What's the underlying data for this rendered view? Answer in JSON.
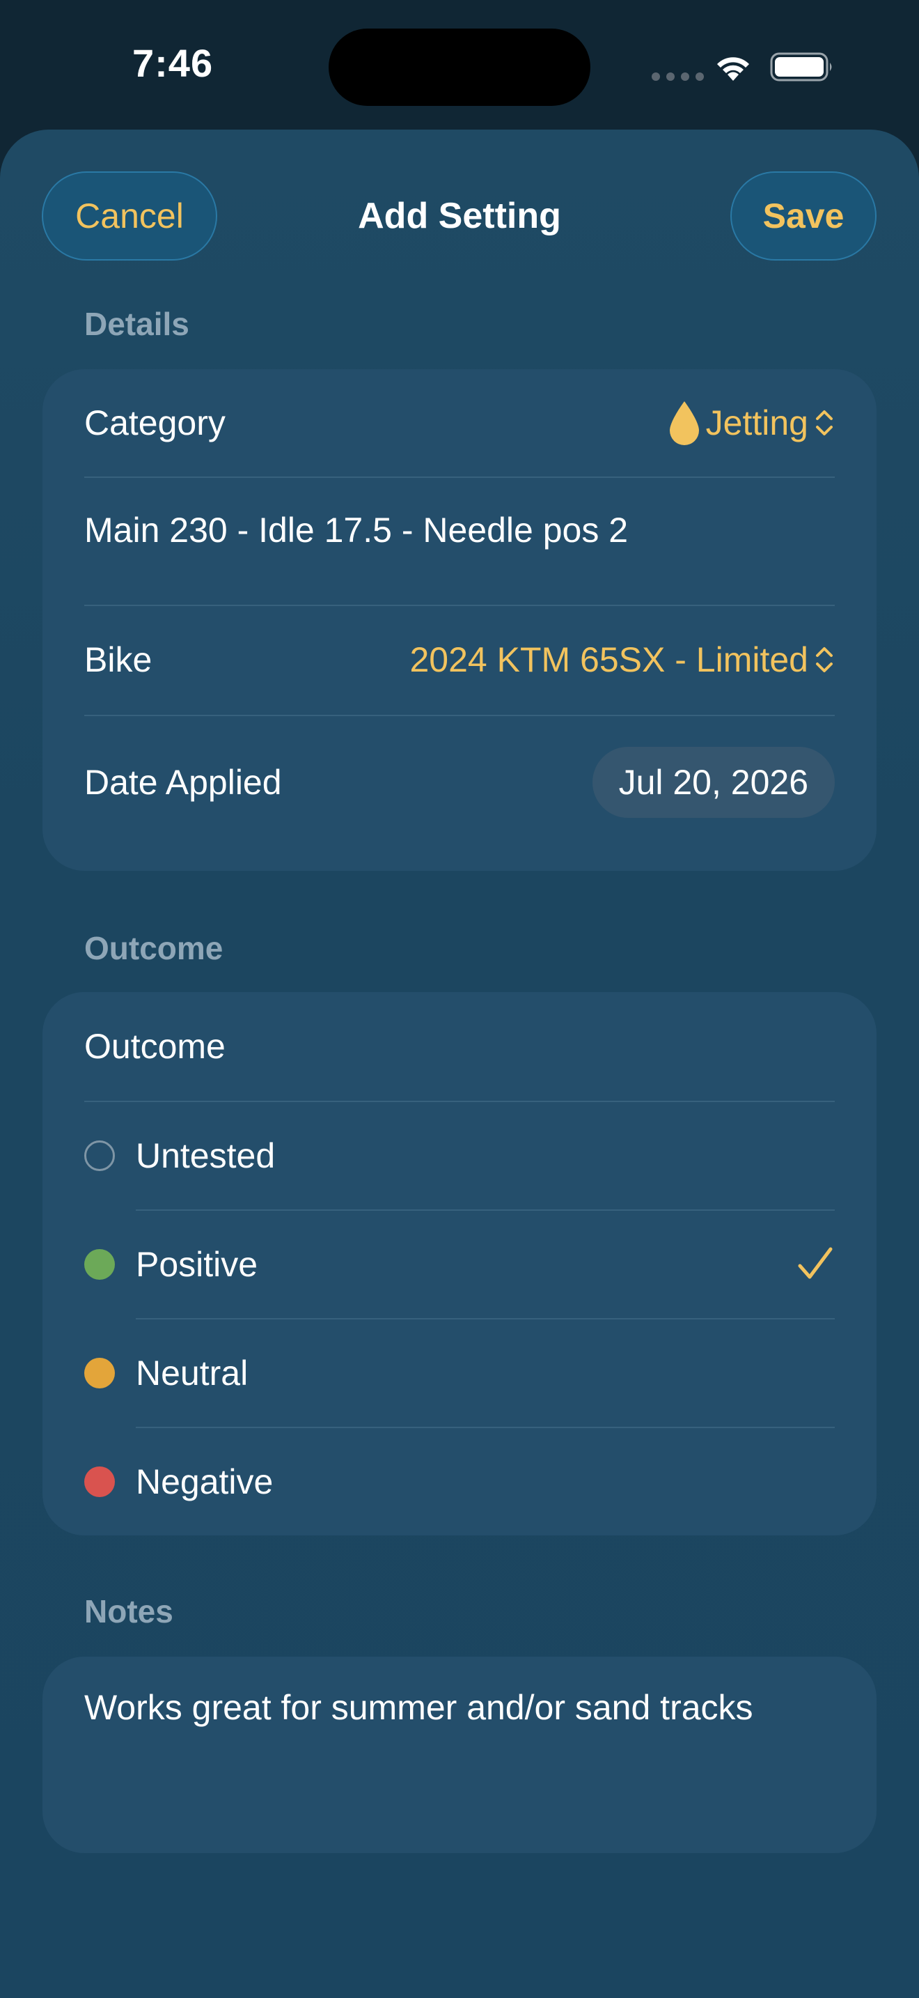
{
  "status_bar": {
    "time": "7:46"
  },
  "nav": {
    "cancel_label": "Cancel",
    "title": "Add Setting",
    "save_label": "Save"
  },
  "details": {
    "header": "Details",
    "category_label": "Category",
    "category_value": "Jetting",
    "category_icon": "drop-icon",
    "setting_text": "Main 230 - Idle 17.5 - Needle pos 2",
    "bike_label": "Bike",
    "bike_value": "2024 KTM 65SX - Limited",
    "date_label": "Date Applied",
    "date_value": "Jul 20, 2026"
  },
  "outcome": {
    "header": "Outcome",
    "picker_label": "Outcome",
    "options": [
      {
        "label": "Untested",
        "color": "#7f96a6",
        "style": "outline",
        "selected": false
      },
      {
        "label": "Positive",
        "color": "#6ca958",
        "style": "filled",
        "selected": true
      },
      {
        "label": "Neutral",
        "color": "#e3a53a",
        "style": "filled",
        "selected": false
      },
      {
        "label": "Negative",
        "color": "#d9534f",
        "style": "filled",
        "selected": false
      }
    ]
  },
  "notes": {
    "header": "Notes",
    "text": "Works great for summer and/or sand tracks"
  },
  "colors": {
    "accent": "#f2c35e",
    "card_bg": "#244e6b",
    "sheet_bg": "#1d4761"
  }
}
